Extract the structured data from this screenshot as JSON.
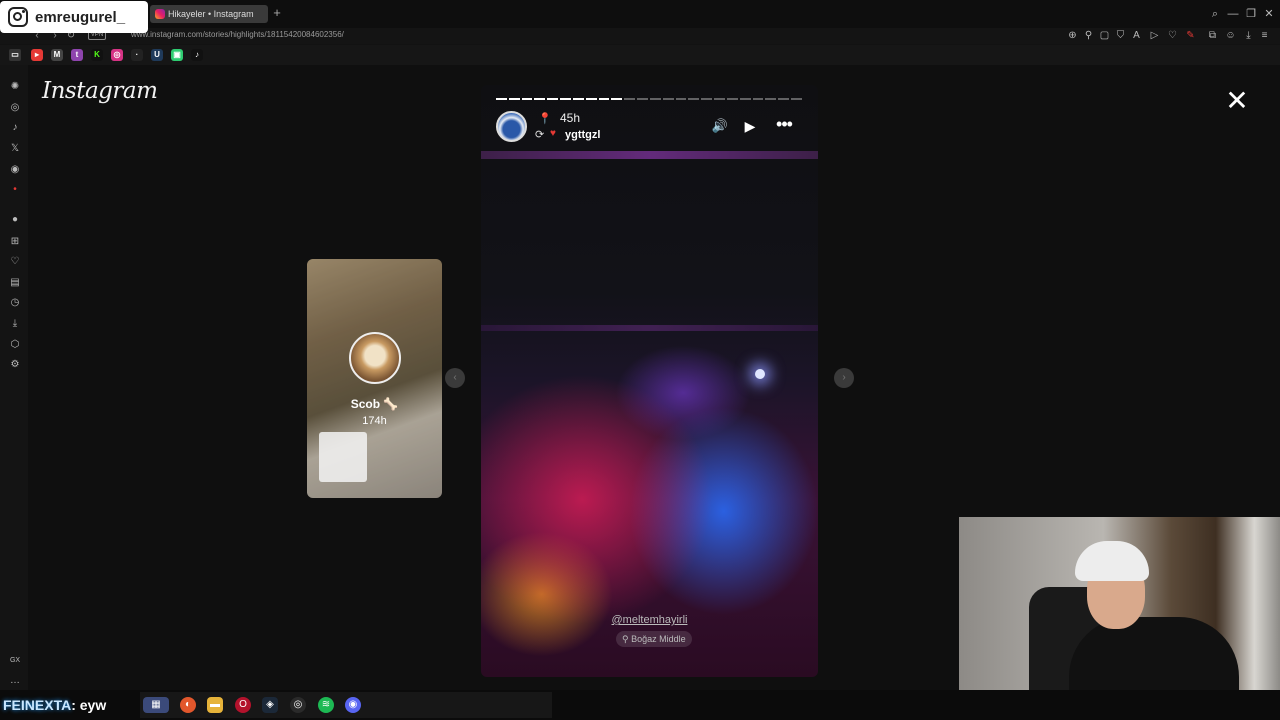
{
  "overlay": {
    "streamer_username": "emreugurel_"
  },
  "browser": {
    "tab_title": "Hikayeler • Instagram",
    "new_tab": "+",
    "url": "www.instagram.com/stories/highlights/18115420084602356/",
    "vpn_label": "VPN",
    "bookmarks": [
      "youtube-bookmark",
      "gmail-bookmark",
      "twitch-bookmark",
      "kick-bookmark",
      "instagram-bookmark",
      "x-bookmark",
      "bookmark-7",
      "bookmark-8",
      "bookmark-9"
    ]
  },
  "sidebar": {
    "bottom_label": "GX"
  },
  "instagram": {
    "logo_text": "Instagram",
    "preview": {
      "name": "Scob 🦴",
      "time": "174h"
    },
    "story": {
      "progress": {
        "segments": 24,
        "completed": 10
      },
      "time": "45h",
      "repost_user": "ygttgzl",
      "mention": "@meltemhayirli",
      "location": "Boğaz Middle"
    }
  },
  "taskbar": {
    "chat_user": "FEINEXTA",
    "chat_message": ": eyw"
  },
  "colors": {
    "accent_red": "#e53935",
    "page_bg": "#0f0f0f",
    "tab_active": "#3a3a3a"
  }
}
